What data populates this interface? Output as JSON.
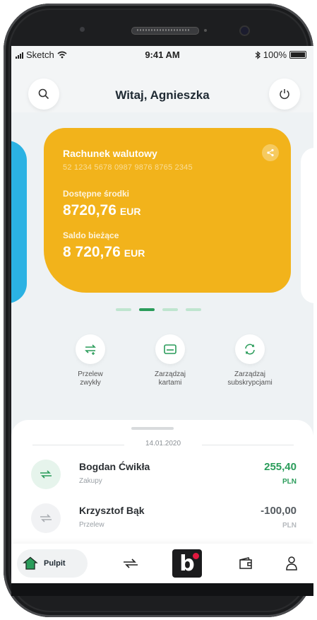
{
  "status_bar": {
    "carrier": "Sketch",
    "time": "9:41 AM",
    "battery": "100%"
  },
  "header": {
    "greeting": "Witaj, Agnieszka"
  },
  "account_card": {
    "name": "Rachunek walutowy",
    "number": "52 1234 5678 0987 9876 8765 2345",
    "available_label": "Dostępne środki",
    "available_amount": "8720,76",
    "available_currency": "EUR",
    "balance_label": "Saldo bieżące",
    "balance_amount": "8 720,76",
    "balance_currency": "EUR",
    "color": "#f2b31b"
  },
  "carousel": {
    "active_index": 1,
    "count": 4
  },
  "quick_actions": [
    {
      "line1": "Przelew",
      "line2": "zwykły",
      "icon": "transfer-icon"
    },
    {
      "line1": "Zarządzaj",
      "line2": "kartami",
      "icon": "card-icon"
    },
    {
      "line1": "Zarządzaj",
      "line2": "subskrypcjami",
      "icon": "refresh-icon"
    }
  ],
  "history": {
    "date": "14.01.2020",
    "transactions": [
      {
        "name": "Bogdan Ćwikła",
        "category": "Zakupy",
        "amount": "255,40",
        "currency": "PLN",
        "color": "#2a9c5a"
      },
      {
        "name": "Krzysztof Bąk",
        "category": "Przelew",
        "amount": "-100,00",
        "currency": "PLN",
        "color": "#555b60"
      }
    ]
  },
  "bottom_nav": {
    "home_label": "Pulpit",
    "brand": "b"
  }
}
